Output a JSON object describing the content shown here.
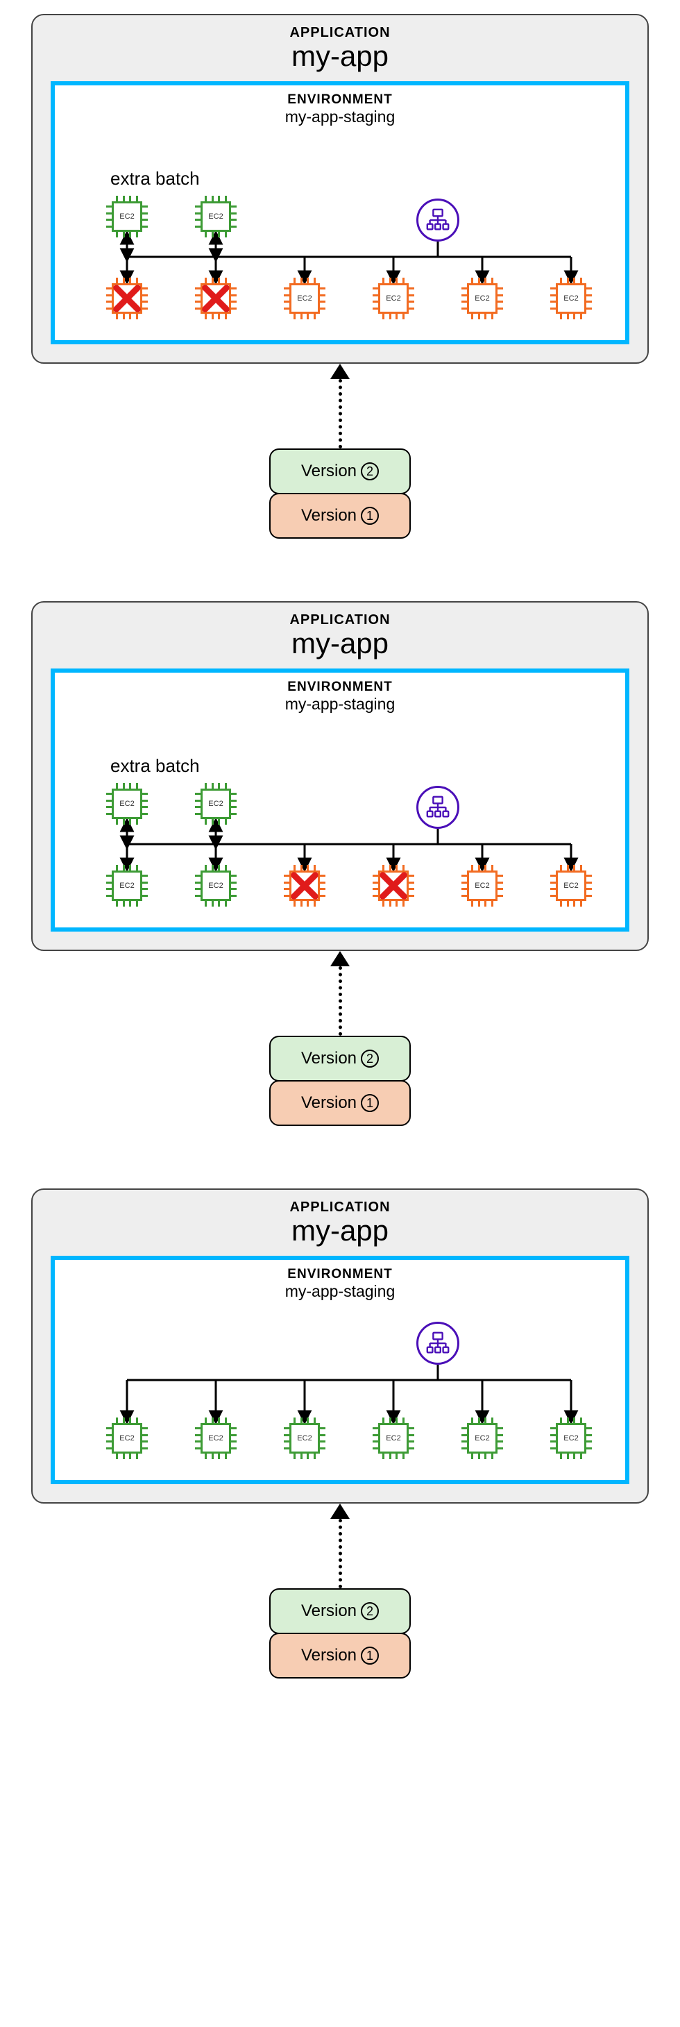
{
  "labels": {
    "application": "APPLICATION",
    "environment": "ENVIRONMENT",
    "extra_batch": "extra batch",
    "ec2": "EC2",
    "version_prefix": "Version"
  },
  "app_name": "my-app",
  "env_name": "my-app-staging",
  "versions": [
    {
      "n": "2",
      "color": "green"
    },
    {
      "n": "1",
      "color": "orange"
    }
  ],
  "panels": [
    {
      "show_extra_batch": true,
      "top_row": [
        {
          "color": "green",
          "failed": false
        },
        {
          "color": "green",
          "failed": false
        }
      ],
      "bottom_row": [
        {
          "color": "orange",
          "failed": true
        },
        {
          "color": "orange",
          "failed": true
        },
        {
          "color": "orange",
          "failed": false
        },
        {
          "color": "orange",
          "failed": false
        },
        {
          "color": "orange",
          "failed": false
        },
        {
          "color": "orange",
          "failed": false
        }
      ]
    },
    {
      "show_extra_batch": true,
      "top_row": [
        {
          "color": "green",
          "failed": false
        },
        {
          "color": "green",
          "failed": false
        }
      ],
      "bottom_row": [
        {
          "color": "green",
          "failed": false
        },
        {
          "color": "green",
          "failed": false
        },
        {
          "color": "orange",
          "failed": true
        },
        {
          "color": "orange",
          "failed": true
        },
        {
          "color": "orange",
          "failed": false
        },
        {
          "color": "orange",
          "failed": false
        }
      ]
    },
    {
      "show_extra_batch": false,
      "top_row": [],
      "bottom_row": [
        {
          "color": "green",
          "failed": false
        },
        {
          "color": "green",
          "failed": false
        },
        {
          "color": "green",
          "failed": false
        },
        {
          "color": "green",
          "failed": false
        },
        {
          "color": "green",
          "failed": false
        },
        {
          "color": "green",
          "failed": false
        }
      ]
    }
  ]
}
